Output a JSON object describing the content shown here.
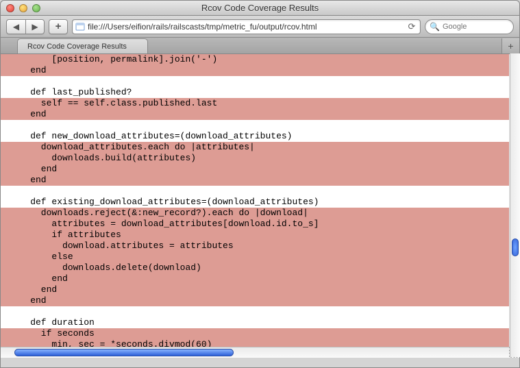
{
  "window": {
    "title": "Rcov Code Coverage Results"
  },
  "toolbar": {
    "url": "file:///Users/eifion/rails/railscasts/tmp/metric_fu/output/rcov.html",
    "search_placeholder": "Google"
  },
  "tab": {
    "label": "Rcov Code Coverage Results"
  },
  "code_lines": [
    {
      "covered": false,
      "text": "        [position, permalink].join('-')"
    },
    {
      "covered": false,
      "text": "    end"
    },
    {
      "covered": true,
      "text": ""
    },
    {
      "covered": true,
      "text": "    def last_published?"
    },
    {
      "covered": false,
      "text": "      self == self.class.published.last"
    },
    {
      "covered": false,
      "text": "    end"
    },
    {
      "covered": true,
      "text": ""
    },
    {
      "covered": true,
      "text": "    def new_download_attributes=(download_attributes)"
    },
    {
      "covered": false,
      "text": "      download_attributes.each do |attributes|"
    },
    {
      "covered": false,
      "text": "        downloads.build(attributes)"
    },
    {
      "covered": false,
      "text": "      end"
    },
    {
      "covered": false,
      "text": "    end"
    },
    {
      "covered": true,
      "text": ""
    },
    {
      "covered": true,
      "text": "    def existing_download_attributes=(download_attributes)"
    },
    {
      "covered": false,
      "text": "      downloads.reject(&:new_record?).each do |download|"
    },
    {
      "covered": false,
      "text": "        attributes = download_attributes[download.id.to_s]"
    },
    {
      "covered": false,
      "text": "        if attributes"
    },
    {
      "covered": false,
      "text": "          download.attributes = attributes"
    },
    {
      "covered": false,
      "text": "        else"
    },
    {
      "covered": false,
      "text": "          downloads.delete(download)"
    },
    {
      "covered": false,
      "text": "        end"
    },
    {
      "covered": false,
      "text": "      end"
    },
    {
      "covered": false,
      "text": "    end"
    },
    {
      "covered": true,
      "text": ""
    },
    {
      "covered": true,
      "text": "    def duration"
    },
    {
      "covered": false,
      "text": "      if seconds"
    },
    {
      "covered": false,
      "text": "        min, sec = *seconds.divmod(60)"
    }
  ]
}
